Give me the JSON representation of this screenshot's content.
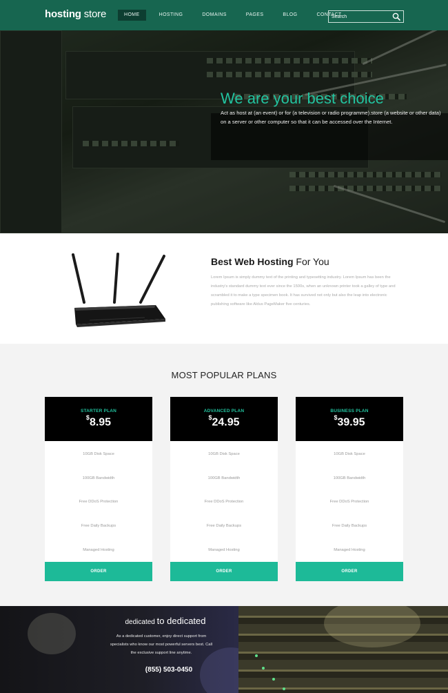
{
  "header": {
    "logo_bold": "hosting",
    "logo_rest": "store",
    "nav": [
      "HOME",
      "HOSTING",
      "DOMAINS",
      "PAGES",
      "BLOG",
      "CONTACT"
    ],
    "active_index": 0,
    "search_placeholder": "Search"
  },
  "hero": {
    "title": "We are your best choice",
    "text": "Act as host at (an event) or for (a television or radio programme).store (a website or other data) on a server or other computer so that it can be accessed over the Internet."
  },
  "about": {
    "title_bold": "Best Web Hosting",
    "title_rest": "For You",
    "text": "Lorem Ipsum is simply dummy text of the printing and typesetting industry. Lorem Ipsum has been the industry's standard dummy text ever since the 1500s, when an unknown printer took a galley of type and scrambled it to make a type specimen book. It has survived not only but also the leap into electronic publishing software like Aldus PageMaker five centuries."
  },
  "plans": {
    "title": "MOST POPULAR PLANS",
    "items": [
      {
        "name": "STARTER PLAN",
        "currency": "$",
        "price": "8.95",
        "features": [
          "10GB Disk Space",
          "100GB Bandwidth",
          "Free DDoS Protection",
          "Free Daily Backups",
          "Managed Hosting"
        ],
        "button": "ORDER"
      },
      {
        "name": "ADVANCED PLAN",
        "currency": "$",
        "price": "24.95",
        "features": [
          "10GB Disk Space",
          "100GB Bandwidth",
          "Free DDoS Protection",
          "Free Daily Backups",
          "Managed Hosting"
        ],
        "button": "ORDER"
      },
      {
        "name": "BUSINESS PLAN",
        "currency": "$",
        "price": "39.95",
        "features": [
          "10GB Disk Space",
          "100GB Bandwidth",
          "Free DDoS Protection",
          "Free Daily Backups",
          "Managed Hosting"
        ],
        "button": "ORDER"
      }
    ]
  },
  "dedicated": {
    "title_small": "dedicated",
    "title_big": "to dedicated",
    "text": "As a dedicated customer, enjoy direct support from specialists who know our most powerful servers best. Call the exclusive support line anytime.",
    "phone": "(855) 503-0450"
  },
  "colors": {
    "header_bg": "#176650",
    "accent": "#22c4a0",
    "button": "#1dba98"
  },
  "icons": {
    "search": "search-icon",
    "router": "router-image"
  }
}
